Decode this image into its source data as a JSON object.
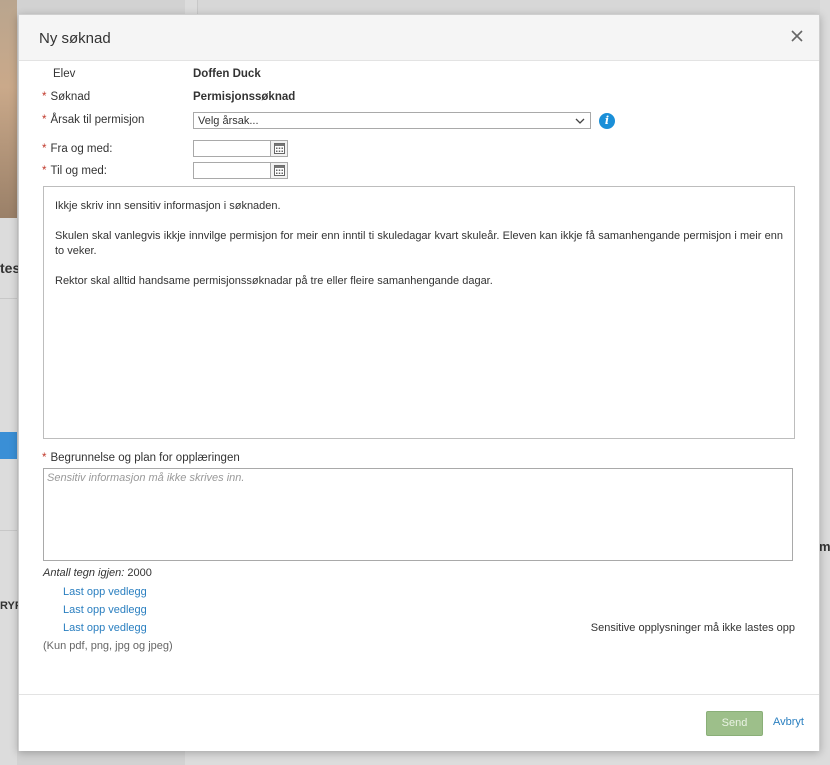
{
  "background": {
    "fragment_left_top": "tes",
    "fragment_left_bottom": "RYF",
    "fragment_right": "m"
  },
  "modal": {
    "title": "Ny søknad",
    "close_icon": "close-icon",
    "fields": {
      "elev_label": "Elev",
      "elev_value": "Doffen Duck",
      "soknad_label": "Søknad",
      "soknad_value": "Permisjonssøknad",
      "arsak_label": "Årsak til permisjon",
      "arsak_select": "Velg årsak...",
      "fra_label": "Fra og med:",
      "til_label": "Til og med:"
    },
    "info_paragraphs": [
      "Ikkje skriv inn sensitiv informasjon i søknaden.",
      "Skulen skal vanlegvis ikkje innvilge permisjon for meir enn inntil ti skuledagar kvart skuleår. Eleven kan ikkje få samanhengande permisjon i meir enn to veker.",
      "Rektor skal alltid handsame permisjonssøknadar på tre eller fleire samanhengande dagar."
    ],
    "begrunnelse_label": "Begrunnelse og plan for opplæringen",
    "begrunnelse_placeholder": "Sensitiv informasjon må ikke skrives inn.",
    "counter_label": "Antall tegn igjen:",
    "counter_value": "2000",
    "upload_links": [
      "Last opp vedlegg",
      "Last opp vedlegg",
      "Last opp vedlegg"
    ],
    "sensitive_note": "Sensitive opplysninger må ikke lastes opp",
    "file_types_note": "(Kun pdf, png, jpg og jpeg)",
    "footer": {
      "send_label": "Send",
      "cancel_label": "Avbryt"
    }
  },
  "colors": {
    "required_star": "#c0392b",
    "link": "#2a7fc0",
    "info_icon": "#1a8fd8",
    "send_button": "#9dbf8a"
  }
}
